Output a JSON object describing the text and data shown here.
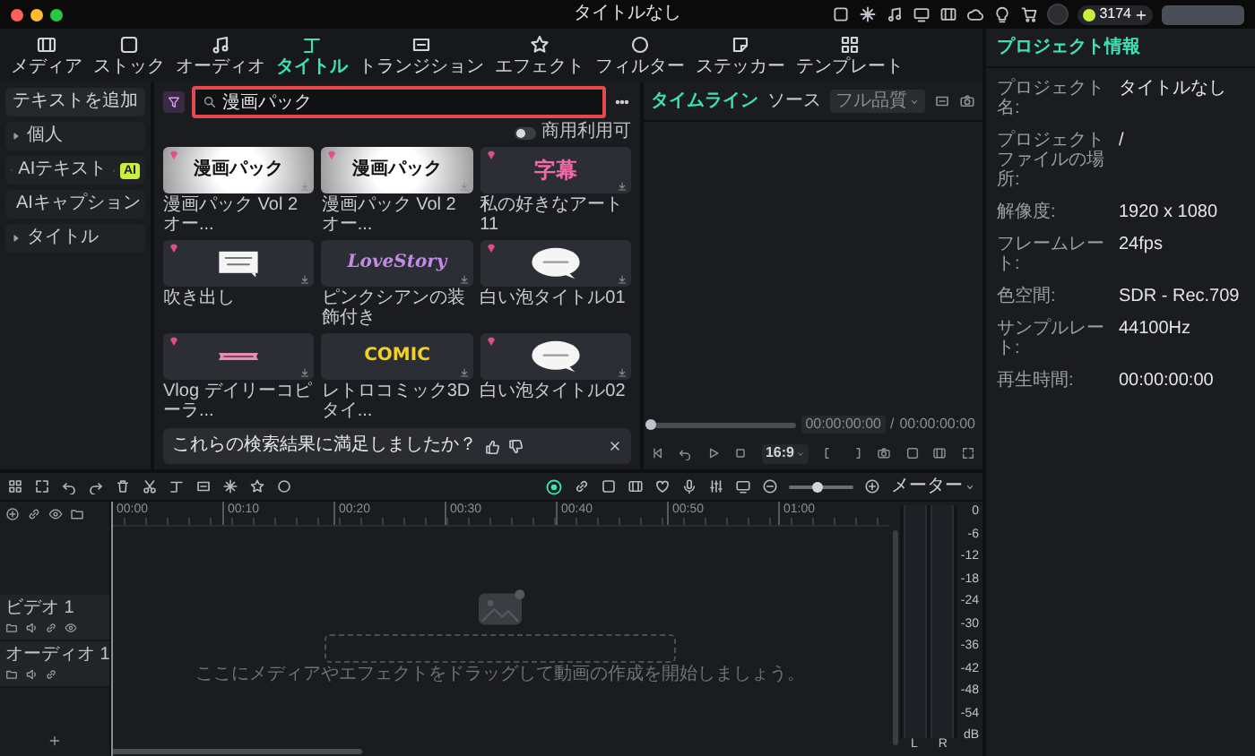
{
  "window": {
    "title": "タイトルなし"
  },
  "account": {
    "credits": "3174"
  },
  "media_tabs": [
    {
      "label": "メディア",
      "selected": false
    },
    {
      "label": "ストック",
      "selected": false
    },
    {
      "label": "オーディオ",
      "selected": false
    },
    {
      "label": "タイトル",
      "selected": true
    },
    {
      "label": "トランジション",
      "selected": false
    },
    {
      "label": "エフェクト",
      "selected": false
    },
    {
      "label": "フィルター",
      "selected": false
    },
    {
      "label": "ステッカー",
      "selected": false
    },
    {
      "label": "テンプレート",
      "selected": false
    }
  ],
  "sidebar": {
    "add_button": "テキストを追加",
    "items": [
      {
        "label": "個人"
      },
      {
        "label": "AIテキスト",
        "badge": "AI",
        "info": true
      },
      {
        "label": "AIキャプション"
      },
      {
        "label": "タイトル"
      }
    ]
  },
  "search": {
    "value": "漫画パック",
    "highlighted": true
  },
  "commercial_filter": {
    "label": "商用利用可",
    "on": false
  },
  "results": [
    {
      "title": "漫画パック Vol 2 オー...",
      "kind": "manga",
      "preview_text": "漫画パック",
      "premium": true
    },
    {
      "title": "漫画パック Vol 2 オー...",
      "kind": "manga",
      "preview_text": "漫画パック",
      "premium": true
    },
    {
      "title": "私の好きなアート 11",
      "kind": "pink",
      "preview_text": "字幕",
      "premium": true
    },
    {
      "title": "吹き出し",
      "kind": "note",
      "premium": true
    },
    {
      "title": "ピンクシアンの装飾付き",
      "kind": "script",
      "preview_text": "LoveStory",
      "premium": false
    },
    {
      "title": "白い泡タイトル01",
      "kind": "bubble",
      "premium": true
    },
    {
      "title": "Vlog デイリーコピーラ...",
      "kind": "banner",
      "premium": true
    },
    {
      "title": "レトロコミック3Dタイ...",
      "kind": "comic",
      "preview_text": "COMIC",
      "premium": false
    },
    {
      "title": "白い泡タイトル02",
      "kind": "bubble",
      "premium": true
    }
  ],
  "feedback": {
    "question": "これらの検索結果に満足しましたか？"
  },
  "preview": {
    "tabs": [
      {
        "label": "タイムライン",
        "selected": true
      },
      {
        "label": "ソース",
        "selected": false
      }
    ],
    "quality": "フル品質",
    "level": 0,
    "current_time": "00:00:00:00",
    "separator": "/",
    "total_time": "00:00:00:00",
    "aspect": "16:9"
  },
  "project_info": {
    "title": "プロジェクト情報",
    "rows": [
      {
        "label": "プロジェクト名:",
        "value": "タイトルなし"
      },
      {
        "label": "プロジェクトファイルの場所:",
        "value": "/"
      },
      {
        "label": "解像度:",
        "value": "1920 x 1080"
      },
      {
        "label": "フレームレート:",
        "value": "24fps"
      },
      {
        "label": "色空間:",
        "value": "SDR - Rec.709"
      },
      {
        "label": "サンプルレート:",
        "value": "44100Hz"
      },
      {
        "label": "再生時間:",
        "value": "00:00:00:00"
      }
    ]
  },
  "timeline": {
    "ruler": [
      "00:00",
      "00:10",
      "00:20",
      "00:30",
      "00:40",
      "00:50",
      "01:00"
    ],
    "tracks": [
      {
        "label": "ビデオ 1",
        "kind": "video"
      },
      {
        "label": "オーディオ 1",
        "kind": "audio"
      }
    ],
    "drop_hint": "ここにメディアやエフェクトをドラッグして動画の作成を開始しましょう。",
    "view": "メーター",
    "zoom": {
      "level": 0.45
    },
    "meter": {
      "scale": [
        "0",
        "-6",
        "-12",
        "-18",
        "-24",
        "-30",
        "-36",
        "-42",
        "-48",
        "-54",
        "dB"
      ],
      "channels": [
        "L",
        "R"
      ]
    }
  }
}
